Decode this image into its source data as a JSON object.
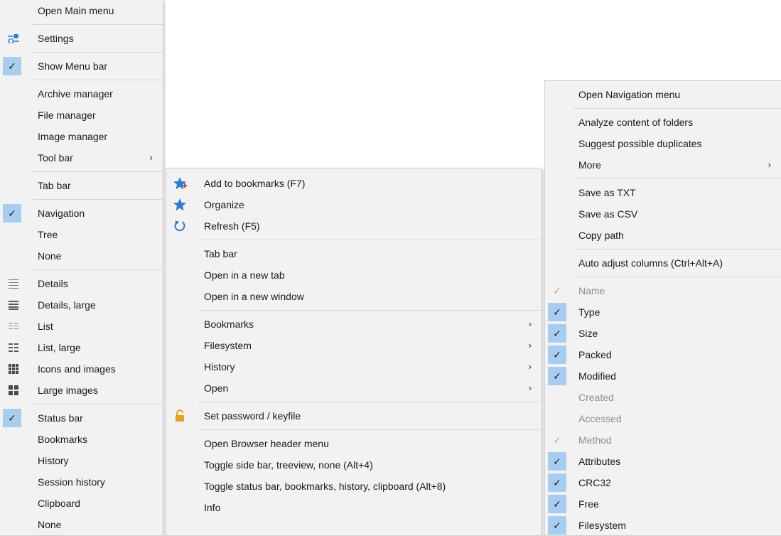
{
  "colors": {
    "menu_bg": "#f2f2f2",
    "check_bg": "#a8cdf1",
    "disabled_text": "#8e8e8e",
    "star_blue": "#2b7cd3",
    "lock_orange": "#e8a020"
  },
  "main_menu": {
    "items": [
      {
        "label": "Open Main menu"
      },
      {
        "label": "Settings",
        "icon": "settings-sliders-icon"
      },
      {
        "label": "Show Menu bar",
        "checked": true
      },
      {
        "label": "Archive manager"
      },
      {
        "label": "File manager"
      },
      {
        "label": "Image manager"
      },
      {
        "label": "Tool bar",
        "arrow": "›"
      },
      {
        "label": "Tab bar"
      },
      {
        "label": "Navigation",
        "checked": true
      },
      {
        "label": "Tree"
      },
      {
        "label": "None"
      },
      {
        "label": "Details",
        "icon": "details-view-icon"
      },
      {
        "label": "Details, large",
        "icon": "details-large-view-icon"
      },
      {
        "label": "List",
        "icon": "list-view-icon"
      },
      {
        "label": "List, large",
        "icon": "list-large-view-icon"
      },
      {
        "label": "Icons and images",
        "icon": "icons-view-icon"
      },
      {
        "label": "Large images",
        "icon": "large-images-view-icon"
      },
      {
        "label": "Status bar",
        "checked": true
      },
      {
        "label": "Bookmarks"
      },
      {
        "label": "History"
      },
      {
        "label": "Session history"
      },
      {
        "label": "Clipboard"
      },
      {
        "label": "None"
      }
    ]
  },
  "browser_menu": {
    "items": [
      {
        "label": "Add to bookmarks (F7)",
        "icon": "add-bookmark-star-icon"
      },
      {
        "label": "Organize",
        "icon": "organize-star-icon"
      },
      {
        "label": "Refresh (F5)",
        "icon": "refresh-icon"
      },
      {
        "label": "Tab bar"
      },
      {
        "label": "Open in a new tab"
      },
      {
        "label": "Open in a new window"
      },
      {
        "label": "Bookmarks",
        "arrow": "›"
      },
      {
        "label": "Filesystem",
        "arrow": "›"
      },
      {
        "label": "History",
        "arrow": "›"
      },
      {
        "label": "Open",
        "arrow": "›"
      },
      {
        "label": "Set password / keyfile",
        "icon": "lock-icon"
      },
      {
        "label": "Open Browser header menu"
      },
      {
        "label": "Toggle side bar, treeview, none (Alt+4)"
      },
      {
        "label": "Toggle status bar, bookmarks, history, clipboard (Alt+8)"
      },
      {
        "label": "Info"
      }
    ]
  },
  "nav_menu": {
    "items": [
      {
        "label": "Open Navigation menu"
      },
      {
        "label": "Analyze content of folders"
      },
      {
        "label": "Suggest possible duplicates"
      },
      {
        "label": "More",
        "arrow": "›"
      },
      {
        "label": "Save as TXT"
      },
      {
        "label": "Save as CSV"
      },
      {
        "label": "Copy path"
      },
      {
        "label": "Auto adjust columns (Ctrl+Alt+A)"
      },
      {
        "label": "Name",
        "checked": true,
        "disabled": true
      },
      {
        "label": "Type",
        "checked": true
      },
      {
        "label": "Size",
        "checked": true
      },
      {
        "label": "Packed",
        "checked": true
      },
      {
        "label": "Modified",
        "checked": true
      },
      {
        "label": "Created",
        "disabled": true
      },
      {
        "label": "Accessed",
        "disabled": true
      },
      {
        "label": "Method",
        "checked": true,
        "disabled": true
      },
      {
        "label": "Attributes",
        "checked": true
      },
      {
        "label": "CRC32",
        "checked": true
      },
      {
        "label": "Free",
        "checked": true
      },
      {
        "label": "Filesystem",
        "checked": true
      }
    ]
  }
}
